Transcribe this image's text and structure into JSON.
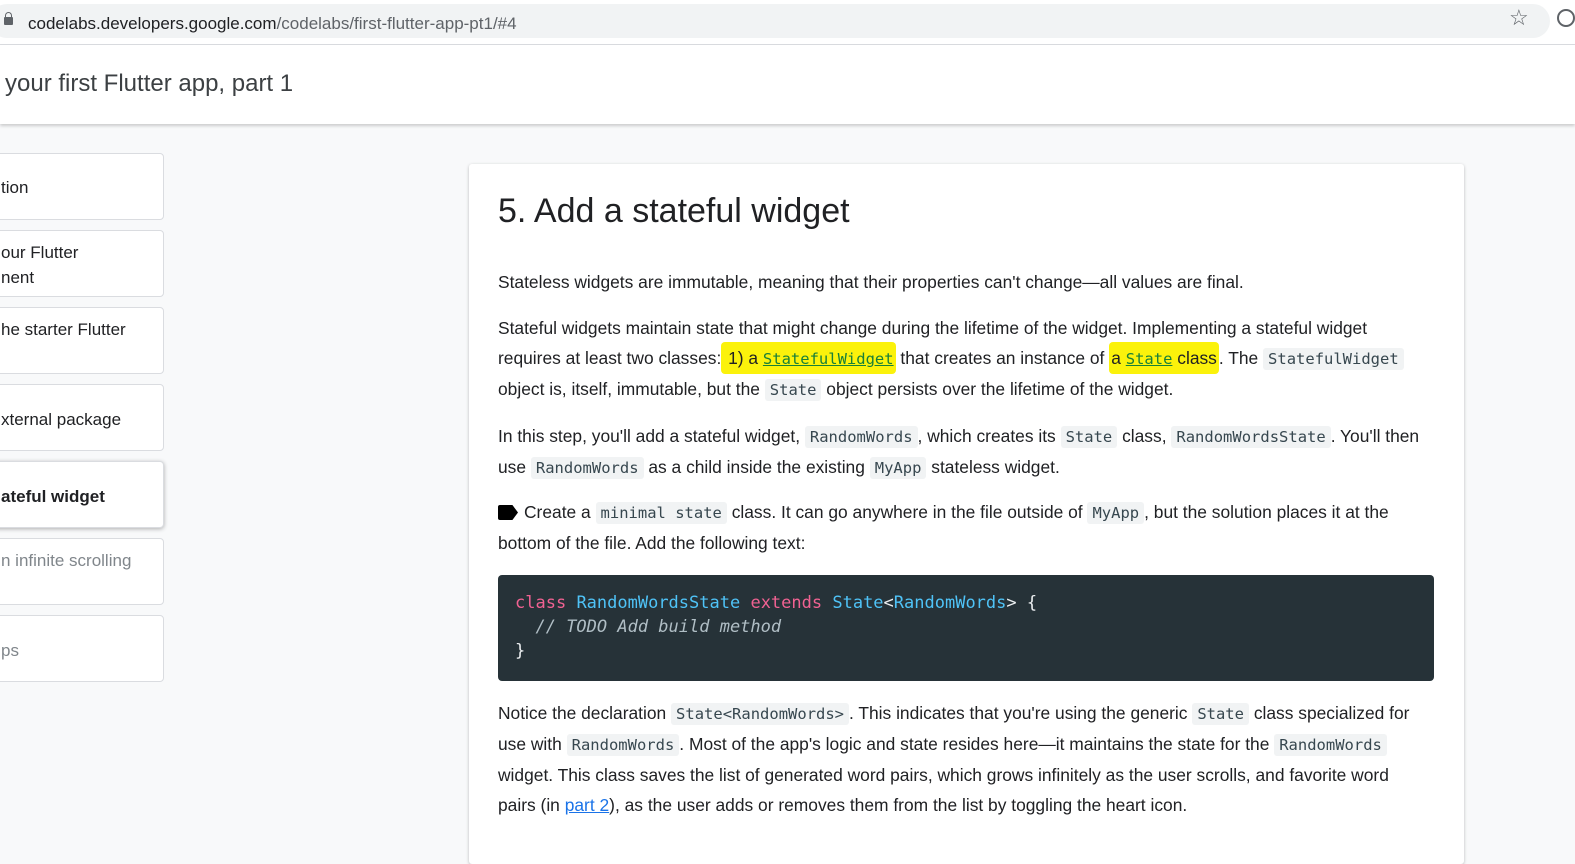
{
  "browser": {
    "url_host": "codelabs.developers.google.com",
    "url_path": "/codelabs/first-flutter-app-pt1/#4",
    "star_icon": "☆"
  },
  "header": {
    "title": "your first Flutter app, part 1"
  },
  "sidebar": {
    "items": [
      {
        "label": "tion"
      },
      {
        "label": "our Flutter\nnent"
      },
      {
        "label": "he starter Flutter"
      },
      {
        "label": "xternal package"
      },
      {
        "label": "ateful widget"
      },
      {
        "label": "n infinite scrolling"
      },
      {
        "label": "ps"
      }
    ]
  },
  "content": {
    "heading": "5. Add a stateful widget",
    "p1": "Stateless widgets are immutable, meaning that their properties can't change—all values are final.",
    "p2": {
      "t1": "Stateful widgets maintain state that might change during the lifetime of the widget. Implementing a stateful widget requires at least two classes:",
      "t2": " 1) a ",
      "link1": "StatefulWidget",
      "t3": " that creates an instance of ",
      "t4": "a ",
      "link2": "State",
      "t5": " class",
      "t6": ". The ",
      "c1": "StatefulWidget",
      "t7": " object is, itself, immutable, but the ",
      "c2": "State",
      "t8": " object persists over the lifetime of the widget."
    },
    "p3": {
      "t1": "In this step, you'll add a stateful widget, ",
      "c1": "RandomWords",
      "t2": ", which creates its ",
      "c2": "State",
      "t3": " class, ",
      "c3": "RandomWordsState",
      "t4": ". You'll then use ",
      "c4": "RandomWords",
      "t5": " as a child inside the existing ",
      "c5": "MyApp",
      "t6": " stateless widget."
    },
    "p4": {
      "t1": "Create a ",
      "c1": "minimal state",
      "t2": " class. It can go anywhere in the file outside of ",
      "c2": "MyApp",
      "t3": ", but the solution places it at the bottom of the file. Add the following text:"
    },
    "code": {
      "kw_class": "class",
      "name": "RandomWordsState",
      "kw_extends": "extends",
      "state": "State",
      "lt": "<",
      "generic": "RandomWords",
      "gt_brace": "> {",
      "comment": "// TODO Add build method",
      "close": "}"
    },
    "p5": {
      "t1": "Notice the declaration ",
      "c1": "State<RandomWords>",
      "t2": ". This indicates that you're using the generic ",
      "c2": "State",
      "t3": " class specialized for use with ",
      "c3": "RandomWords",
      "t4": ". Most of the app's logic and state resides here—it maintains the state for the ",
      "c4": "RandomWords",
      "t5": " widget. This class saves the list of generated word pairs, which grows infinitely as the user scrolls, and favorite word pairs (in ",
      "link": "part 2",
      "t6": "), as the user adds or removes them from the list by toggling the heart icon."
    }
  },
  "colors": {
    "highlight": "#fbf20b",
    "code_bg": "#263238",
    "link": "#1a73e8"
  }
}
